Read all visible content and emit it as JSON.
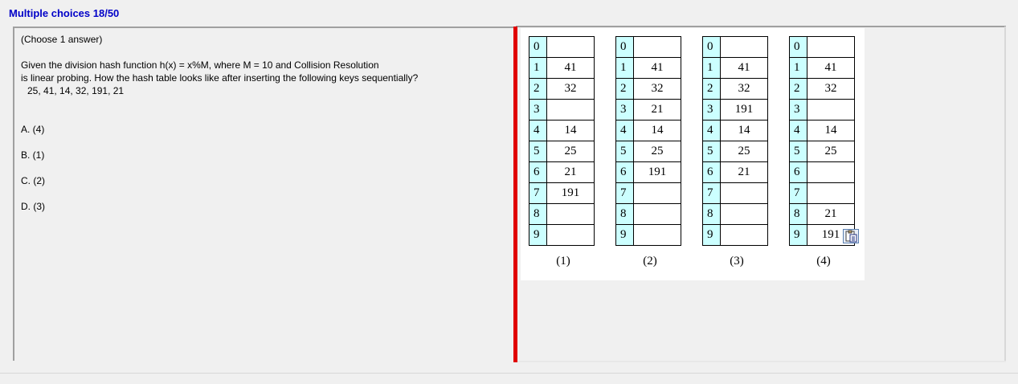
{
  "header": {
    "title": "Multiple choices 18/50"
  },
  "question": {
    "instruction": "(Choose 1 answer)",
    "line1": "Given the division hash function h(x) = x%M, where M = 10 and Collision Resolution",
    "line2": "is linear probing. How the hash table looks like after inserting the following keys sequentially?",
    "keys": "25, 41, 14, 32, 191, 21"
  },
  "options": [
    {
      "label": "A. (4)"
    },
    {
      "label": "B. (1)"
    },
    {
      "label": "C. (2)"
    },
    {
      "label": "D. (3)"
    }
  ],
  "tables": [
    {
      "caption": "(1)",
      "rows": [
        {
          "idx": "0",
          "val": ""
        },
        {
          "idx": "1",
          "val": "41"
        },
        {
          "idx": "2",
          "val": "32"
        },
        {
          "idx": "3",
          "val": ""
        },
        {
          "idx": "4",
          "val": "14"
        },
        {
          "idx": "5",
          "val": "25"
        },
        {
          "idx": "6",
          "val": "21"
        },
        {
          "idx": "7",
          "val": "191"
        },
        {
          "idx": "8",
          "val": ""
        },
        {
          "idx": "9",
          "val": ""
        }
      ]
    },
    {
      "caption": "(2)",
      "rows": [
        {
          "idx": "0",
          "val": ""
        },
        {
          "idx": "1",
          "val": "41"
        },
        {
          "idx": "2",
          "val": "32"
        },
        {
          "idx": "3",
          "val": "21"
        },
        {
          "idx": "4",
          "val": "14"
        },
        {
          "idx": "5",
          "val": "25"
        },
        {
          "idx": "6",
          "val": "191"
        },
        {
          "idx": "7",
          "val": ""
        },
        {
          "idx": "8",
          "val": ""
        },
        {
          "idx": "9",
          "val": ""
        }
      ]
    },
    {
      "caption": "(3)",
      "rows": [
        {
          "idx": "0",
          "val": ""
        },
        {
          "idx": "1",
          "val": "41"
        },
        {
          "idx": "2",
          "val": "32"
        },
        {
          "idx": "3",
          "val": "191"
        },
        {
          "idx": "4",
          "val": "14"
        },
        {
          "idx": "5",
          "val": "25"
        },
        {
          "idx": "6",
          "val": "21"
        },
        {
          "idx": "7",
          "val": ""
        },
        {
          "idx": "8",
          "val": ""
        },
        {
          "idx": "9",
          "val": ""
        }
      ]
    },
    {
      "caption": "(4)",
      "rows": [
        {
          "idx": "0",
          "val": ""
        },
        {
          "idx": "1",
          "val": "41"
        },
        {
          "idx": "2",
          "val": "32"
        },
        {
          "idx": "3",
          "val": ""
        },
        {
          "idx": "4",
          "val": "14"
        },
        {
          "idx": "5",
          "val": "25"
        },
        {
          "idx": "6",
          "val": ""
        },
        {
          "idx": "7",
          "val": ""
        },
        {
          "idx": "8",
          "val": "21"
        },
        {
          "idx": "9",
          "val": "191"
        }
      ]
    }
  ],
  "icons": {
    "paste": "clipboard-paste-icon"
  },
  "colors": {
    "title": "#0000c8",
    "splitter": "#e00000",
    "index_cell": "#ccffff"
  }
}
